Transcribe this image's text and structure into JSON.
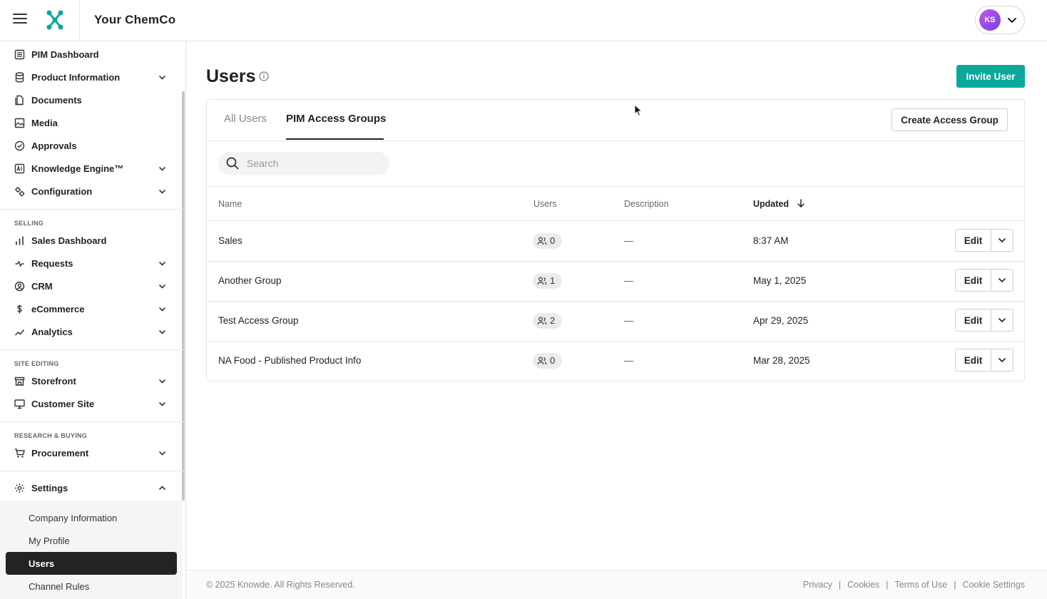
{
  "header": {
    "company_name": "Your ChemCo",
    "avatar_initials": "KS",
    "brand_color": "#0aa89a"
  },
  "sidebar": {
    "main_items": [
      {
        "label": "PIM Dashboard",
        "icon": "dashboard-icon",
        "expandable": false
      },
      {
        "label": "Product Information",
        "icon": "database-icon",
        "expandable": true
      },
      {
        "label": "Documents",
        "icon": "documents-icon",
        "expandable": false
      },
      {
        "label": "Media",
        "icon": "image-icon",
        "expandable": false
      },
      {
        "label": "Approvals",
        "icon": "check-circle-icon",
        "expandable": false
      },
      {
        "label": "Knowledge Engine™",
        "icon": "ai-icon",
        "expandable": true
      },
      {
        "label": "Configuration",
        "icon": "gears-icon",
        "expandable": true
      }
    ],
    "selling_label": "SELLING",
    "selling_items": [
      {
        "label": "Sales Dashboard",
        "icon": "bar-chart-icon",
        "expandable": false
      },
      {
        "label": "Requests",
        "icon": "requests-icon",
        "expandable": true
      },
      {
        "label": "CRM",
        "icon": "user-circle-icon",
        "expandable": true
      },
      {
        "label": "eCommerce",
        "icon": "dollar-icon",
        "expandable": true
      },
      {
        "label": "Analytics",
        "icon": "trend-icon",
        "expandable": true
      }
    ],
    "site_label": "SITE EDITING",
    "site_items": [
      {
        "label": "Storefront",
        "icon": "store-icon",
        "expandable": true
      },
      {
        "label": "Customer Site",
        "icon": "monitor-icon",
        "expandable": true
      }
    ],
    "research_label": "RESEARCH & BUYING",
    "research_items": [
      {
        "label": "Procurement",
        "icon": "cart-icon",
        "expandable": true
      }
    ],
    "settings_label": "Settings",
    "settings_items": [
      {
        "label": "Company Information",
        "active": false
      },
      {
        "label": "My Profile",
        "active": false
      },
      {
        "label": "Users",
        "active": true
      },
      {
        "label": "Channel Rules",
        "active": false
      }
    ]
  },
  "main": {
    "title": "Users",
    "invite_button": "Invite User",
    "tabs": [
      {
        "label": "All Users",
        "active": false
      },
      {
        "label": "PIM Access Groups",
        "active": true
      }
    ],
    "create_button": "Create Access Group",
    "search": {
      "placeholder": "Search",
      "value": ""
    },
    "table": {
      "columns": [
        "Name",
        "Users",
        "Description",
        "Updated"
      ],
      "sorted_column": "Updated",
      "sort_direction": "descending",
      "rows": [
        {
          "name": "Sales",
          "users": "0",
          "description": "—",
          "updated": "8:37 AM"
        },
        {
          "name": "Another Group",
          "users": "1",
          "description": "—",
          "updated": "May 1, 2025"
        },
        {
          "name": "Test Access Group",
          "users": "2",
          "description": "—",
          "updated": "Apr 29, 2025"
        },
        {
          "name": "NA Food - Published Product Info",
          "users": "0",
          "description": "—",
          "updated": "Mar 28, 2025"
        }
      ],
      "edit_label": "Edit"
    }
  },
  "footer": {
    "copyright": "© 2025 Knowde. All Rights Reserved.",
    "links": [
      "Privacy",
      "Cookies",
      "Terms of Use",
      "Cookie Settings"
    ],
    "separator": "|"
  }
}
